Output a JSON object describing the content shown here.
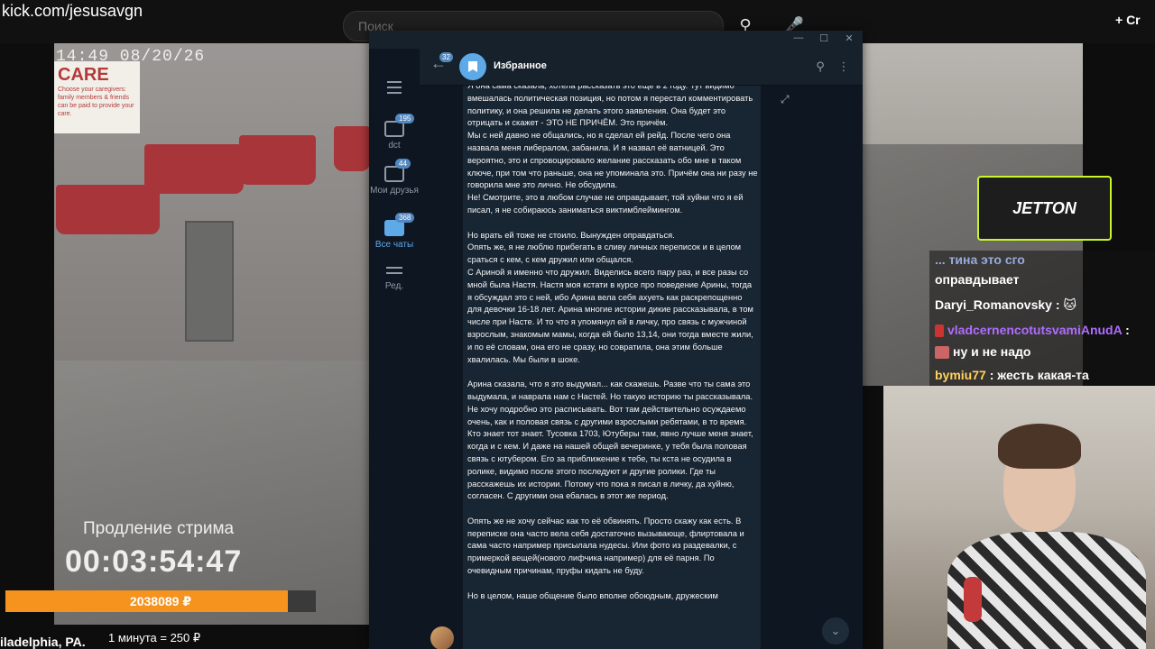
{
  "browser": {
    "url": "kick.com/jesusavgn",
    "search_placeholder": "Поиск",
    "new_button": "+ Cr"
  },
  "stream": {
    "cam_timestamp": "14:49 08/20/26",
    "care_sign": {
      "title": "CARE",
      "subtitle": "Choose your caregivers: family members & friends can be paid to provide your care."
    },
    "extension_label": "Продление стрима",
    "timer": "00:03:54:47",
    "progress_label": "2038089 ₽",
    "progress_fraction": 0.91,
    "location": "iladelphia, PA.",
    "rate": "1 минута = 250 ₽"
  },
  "telegram": {
    "window_controls": [
      "—",
      "☐",
      "✕"
    ],
    "sidebar": {
      "folders": [
        {
          "label": "dct",
          "badge": "195",
          "active": false
        },
        {
          "label": "Мои друзья",
          "badge": "44",
          "active": false
        },
        {
          "label": "Все чаты",
          "badge": "368",
          "active": true
        },
        {
          "label": "Ред.",
          "badge": "",
          "active": false
        }
      ]
    },
    "header": {
      "back_badge": "32",
      "title": "Избранное"
    },
    "message": "Я она сама сказала, хотела рассказать это ещё в 2 году. Тут видимо вмешалась политическая позиция, но потом я перестал комментировать политику, и она решила не делать этого заявления. Она будет это отрицать и скажет - ЭТО НЕ ПРИЧЁМ. Это причём.\nМы с ней давно не общались, но я сделал ей рейд. После чего она назвала меня либералом, забанила. И я назвал её ватницей. Это вероятно, это и спровоцировало желание рассказать обо мне в таком ключе, при том что раньше, она не упоминала это. Причём она ни разу не говорила мне это лично. Не обсудила.\nНе! Смотрите, это в любом случае не оправдывает, той хуйни что я ей писал, я не собираюсь заниматься виктимблеймингом.\n\nНо врать ей тоже не стоило. Вынужден оправдаться.\nОпять же, я не люблю прибегать в сливу личных переписок и в целом сраться с кем, с кем дружил или общался.\nС Ариной я именно что дружил. Виделись всего пару раз, и все разы со мной была Настя. Настя моя кстати в курсе про поведение Арины, тогда я обсуждал это с ней, ибо Арина вела себя ахуеть как раскрепощенно для девочки 16-18 лет. Арина многие истории дикие рассказывала, в том числе при Насте. И то что я упомянул ей в личку, про связь с мужчиной взрослым, знакомым мамы, когда ей было 13,14, они тогда вместе жили, и по её словам, она его не сразу, но совратила, она этим больше хвалилась. Мы были в шоке.\n\nАрина сказала, что я это выдумал... как скажешь. Разве что ты сама это выдумала, и наврала нам с Настей. Но такую историю ты рассказывала. Не хочу подробно это расписывать. Вот там действительно осуждаемо очень, как и половая связь с другими взрослыми ребятами, в то время. Кто знает тот знает. Тусовка 1703, Ютуберы там, явно лучше меня знает, когда и с кем. И даже на нашей общей вечеринке, у тебя была половая связь с ютубером. Его за приближение к тебе, ты кста не осудила в ролике, видимо после этого последуют и другие ролики. Где ты расскажешь их истории. Потому что пока я писал в личку, да хуйню, согласен. С другими она ебалась в этот же период.\n\nОпять же не хочу сейчас как то её обвинять. Просто скажу как есть. В переписке она часто вела себя достаточно вызывающе, флиртовала и сама часто например присылала нудесы. Или фото из раздевалки, с примеркой вещей(нового лифчика например) для её парня. По очевидным причинам, пруфы кидать не буду.\n\nНо в целом, наше общение было вполне обоюдным, дружеским"
  },
  "chat_overlay": {
    "sponsor": "JETTON",
    "lines": [
      {
        "user": "...",
        "text": "тина это сго"
      },
      {
        "user": "",
        "text": "оправдывает"
      },
      {
        "user": "Daryi_Romanovsky",
        "text": ":"
      },
      {
        "user": "vladcernencotutsvamiAnudA",
        "text": ":"
      },
      {
        "user": "",
        "text": "ну и не надо"
      },
      {
        "user": "bymiu77",
        "text": ": жесть какая-та"
      }
    ]
  },
  "colors": {
    "progress": "#f5931e",
    "telegram_accent": "#5ea9e8",
    "jetton_border": "#c9f52a"
  }
}
